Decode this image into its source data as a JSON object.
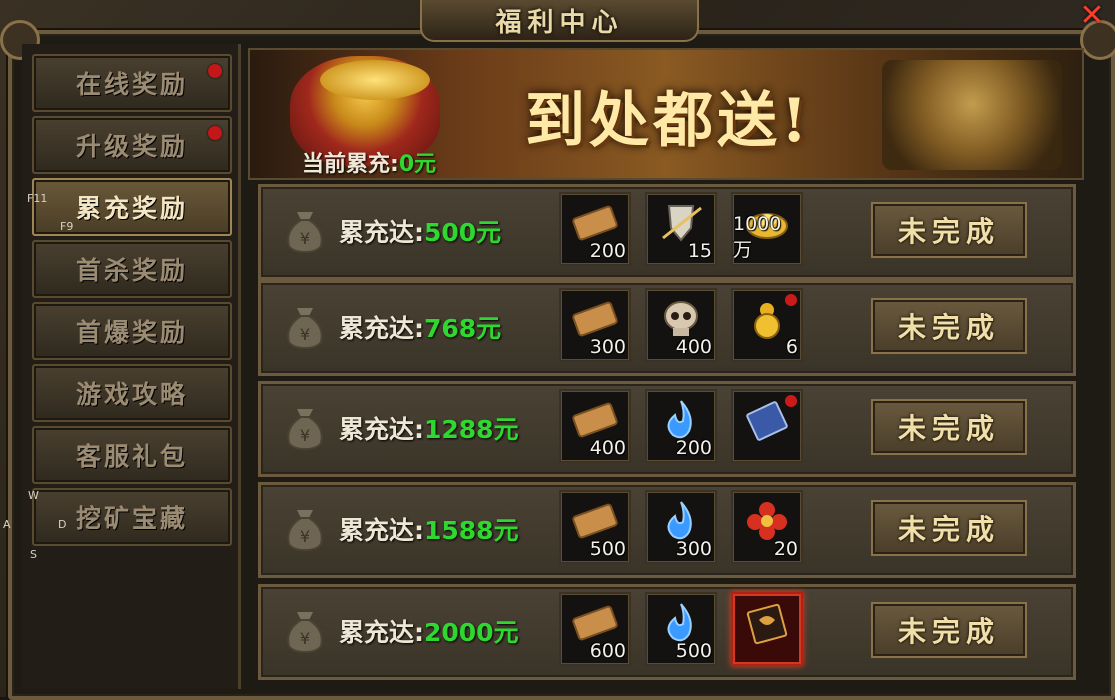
{
  "window": {
    "title": "福利中心",
    "close_glyph": "✕"
  },
  "sidebar": {
    "items": [
      {
        "label": "在线奖励",
        "badge": true,
        "active": false
      },
      {
        "label": "升级奖励",
        "badge": true,
        "active": false
      },
      {
        "label": "累充奖励",
        "badge": false,
        "active": true
      },
      {
        "label": "首杀奖励",
        "badge": false,
        "active": false
      },
      {
        "label": "首爆奖励",
        "badge": false,
        "active": false
      },
      {
        "label": "游戏攻略",
        "badge": false,
        "active": false
      },
      {
        "label": "客服礼包",
        "badge": false,
        "active": false
      },
      {
        "label": "挖矿宝藏",
        "badge": false,
        "active": false
      }
    ],
    "hotkeys": [
      "F11",
      "F9",
      "W",
      "A",
      "D",
      "S"
    ]
  },
  "banner": {
    "slogan": "到处都送!",
    "current_label": "当前累充:",
    "current_value": "0元"
  },
  "rewards_prefix": "累充达:",
  "rewards": [
    {
      "amount": "500元",
      "items": [
        {
          "icon": "scroll-icon",
          "qty": "200"
        },
        {
          "icon": "shield-sword-icon",
          "qty": "15"
        },
        {
          "icon": "gold-ingot-icon",
          "qty": "1000万"
        }
      ],
      "status": "未完成"
    },
    {
      "amount": "768元",
      "items": [
        {
          "icon": "scroll-icon",
          "qty": "300"
        },
        {
          "icon": "skull-icon",
          "qty": "400"
        },
        {
          "icon": "gourd-icon",
          "qty": "6"
        }
      ],
      "status": "未完成"
    },
    {
      "amount": "1288元",
      "items": [
        {
          "icon": "scroll-icon",
          "qty": "400"
        },
        {
          "icon": "blue-flame-icon",
          "qty": "200"
        },
        {
          "icon": "blue-book-icon",
          "qty": ""
        }
      ],
      "status": "未完成"
    },
    {
      "amount": "1588元",
      "items": [
        {
          "icon": "scroll-icon",
          "qty": "500"
        },
        {
          "icon": "blue-flame-icon",
          "qty": "300"
        },
        {
          "icon": "red-flower-icon",
          "qty": "20"
        }
      ],
      "status": "未完成"
    },
    {
      "amount": "2000元",
      "items": [
        {
          "icon": "scroll-icon",
          "qty": "600"
        },
        {
          "icon": "blue-flame-icon",
          "qty": "500"
        },
        {
          "icon": "red-tome-icon",
          "qty": ""
        }
      ],
      "status": "未完成"
    }
  ],
  "colors": {
    "accent_green": "#2fd82f",
    "badge_red": "#c4171a",
    "gold_text": "#f0dfa8"
  }
}
